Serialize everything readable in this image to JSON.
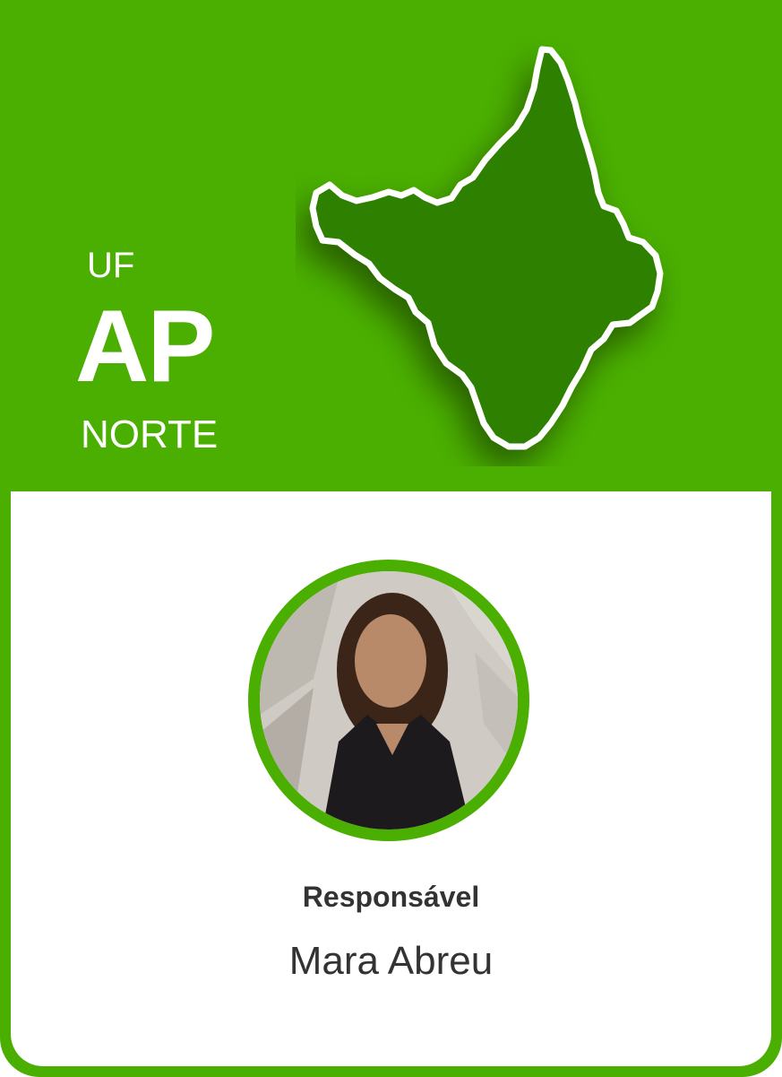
{
  "colors": {
    "brand": "#4aaf00",
    "map_fill": "#2e8000",
    "text_dark": "#333333"
  },
  "state": {
    "uf_label": "UF",
    "code": "AP",
    "region": "NORTE",
    "map_icon": "amapa-state-map-icon"
  },
  "responsible": {
    "label": "Responsável",
    "name": "Mara Abreu",
    "photo_icon": "person-photo"
  }
}
